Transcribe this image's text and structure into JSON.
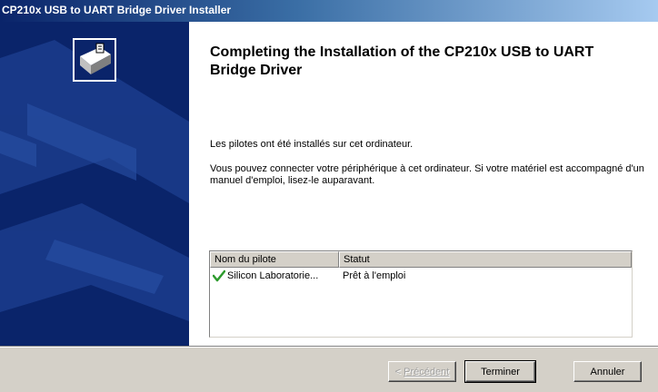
{
  "window": {
    "title": "CP210x USB to UART Bridge Driver Installer"
  },
  "main": {
    "heading": "Completing the Installation of the CP210x USB to UART Bridge Driver",
    "paragraph1": "Les pilotes ont été installés sur cet ordinateur.",
    "paragraph2": "Vous pouvez connecter votre périphérique à cet ordinateur. Si votre matériel est accompagné d'un manuel d'emploi, lisez-le auparavant."
  },
  "driver_list": {
    "columns": [
      "Nom du pilote",
      "Statut"
    ],
    "rows": [
      {
        "name": "Silicon Laboratorie...",
        "status": "Prêt à l'emploi",
        "icon": "checkmark-icon"
      }
    ]
  },
  "buttons": {
    "back": {
      "prefix": "< ",
      "label": "Précédent",
      "enabled": false
    },
    "finish": {
      "label": "Terminer"
    },
    "cancel": {
      "label": "Annuler"
    }
  },
  "colors": {
    "title_bar_start": "#0a246a",
    "side_panel": "#0a246a",
    "dialog_face": "#d4d0c8",
    "checkmark": "#2e9b2e"
  }
}
